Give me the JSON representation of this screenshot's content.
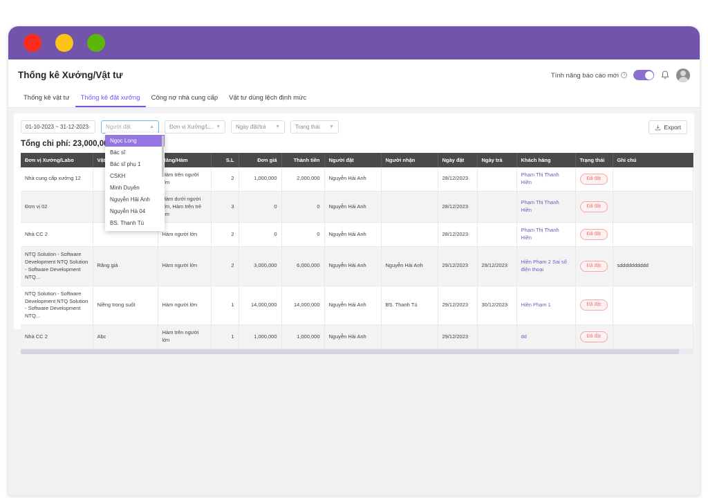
{
  "window": {
    "traffic_lights": [
      "close-red",
      "minimize-yellow",
      "maximize-green"
    ]
  },
  "header": {
    "page_title": "Thống kê Xưởng/Vật tư",
    "report_feature_label": "Tính năng báo cáo mới",
    "toggle_on": true,
    "bell_icon": "bell-icon",
    "avatar": "user-avatar"
  },
  "tabs": [
    {
      "label": "Thống kê vật tư",
      "active": false
    },
    {
      "label": "Thống kê đặt xưởng",
      "active": true
    },
    {
      "label": "Công nợ nhà cung cấp",
      "active": false
    },
    {
      "label": "Vật tư dùng lệch định mức",
      "active": false
    }
  ],
  "filters": {
    "date_range": "01-10-2023 ~ 31-12-2023",
    "date_icon": "calendar-icon",
    "nguoi_dat_placeholder": "Người đặt",
    "nguoi_dat_value": "",
    "don_vi_xuong": "Đơn vị Xưởng/L...",
    "ngay_dat_tra": "Ngày đặt/trả",
    "trang_thai": "Trạng thái",
    "export_label": "Export",
    "export_icon": "download-icon"
  },
  "dropdown": {
    "open": true,
    "options": [
      "Ngọc Long",
      "Bác sĩ",
      "Bác sĩ phụ 1",
      "CSKH",
      "Minh Duyên",
      "Nguyễn Hải Anh",
      "Nguyễn Hà 04",
      "BS. Thanh Tú"
    ],
    "selected_index": 0
  },
  "summary": {
    "total_cost_label": "Tổng chi phí: 23,000,000"
  },
  "table": {
    "columns": [
      "Đơn vị Xưởng/Labo",
      "Vật tư",
      "Răng/Hàm",
      "S.L",
      "Đơn giá",
      "Thành tiền",
      "Người đặt",
      "Người nhận",
      "Ngày đặt",
      "Ngày trả",
      "Khách hàng",
      "Trạng thái",
      "Ghi chú"
    ],
    "rows": [
      {
        "don_vi": "Nhà cung cấp xưởng 12",
        "vat_tu": "",
        "rang_ham": "Hàm trên người lớn",
        "sl": "2",
        "don_gia": "1,000,000",
        "thanh_tien": "2,000,000",
        "nguoi_dat": "Nguyễn Hải Anh",
        "nguoi_nhan": "",
        "ngay_dat": "28/12/2023",
        "ngay_tra": "",
        "khach_hang": "Phạm Thị Thanh Hiền",
        "trang_thai": "Đã đặt",
        "ghi_chu": ""
      },
      {
        "don_vi": "Đơn vị 02",
        "vat_tu": "",
        "rang_ham": "Hàm dưới người lớn, Hàm trên trẻ em",
        "sl": "3",
        "don_gia": "0",
        "thanh_tien": "0",
        "nguoi_dat": "Nguyễn Hải Anh",
        "nguoi_nhan": "",
        "ngay_dat": "28/12/2023",
        "ngay_tra": "",
        "khach_hang": "Phạm Thị Thanh Hiền",
        "trang_thai": "Đã đặt",
        "ghi_chu": ""
      },
      {
        "don_vi": "Nhà CC 2",
        "vat_tu": "",
        "rang_ham": "Hàm người lớn",
        "sl": "2",
        "don_gia": "0",
        "thanh_tien": "0",
        "nguoi_dat": "Nguyễn Hải Anh",
        "nguoi_nhan": "",
        "ngay_dat": "28/12/2023",
        "ngay_tra": "",
        "khach_hang": "Phạm Thị Thanh Hiền",
        "trang_thai": "Đã đặt",
        "ghi_chu": ""
      },
      {
        "don_vi": "NTQ Solution - Software Development NTQ Solution - Software Development NTQ...",
        "vat_tu": "Răng giả",
        "rang_ham": "Hàm người lớn",
        "sl": "2",
        "don_gia": "3,000,000",
        "thanh_tien": "6,000,000",
        "nguoi_dat": "Nguyễn Hải Anh",
        "nguoi_nhan": "Nguyễn Hải Anh",
        "ngay_dat": "29/12/2023",
        "ngay_tra": "29/12/2023",
        "khach_hang": "Hiền Phạm 2 Sai số điện thoại",
        "trang_thai": "Đã đặt",
        "ghi_chu": "sdddddddddd"
      },
      {
        "don_vi": "NTQ Solution - Software Development NTQ Solution - Software Development NTQ...",
        "vat_tu": "Niềng trong suốt",
        "rang_ham": "Hàm người lớn",
        "sl": "1",
        "don_gia": "14,000,000",
        "thanh_tien": "14,000,000",
        "nguoi_dat": "Nguyễn Hải Anh",
        "nguoi_nhan": "BS. Thanh Tú",
        "ngay_dat": "29/12/2023",
        "ngay_tra": "30/12/2023",
        "khach_hang": "Hiền Phạm 1",
        "trang_thai": "Đã đặt",
        "ghi_chu": ""
      },
      {
        "don_vi": "Nhà CC 2",
        "vat_tu": "Abc",
        "rang_ham": "Hàm trên người lớn",
        "sl": "1",
        "don_gia": "1,000,000",
        "thanh_tien": "1,000,000",
        "nguoi_dat": "Nguyễn Hải Anh",
        "nguoi_nhan": "",
        "ngay_dat": "29/12/2023",
        "ngay_tra": "",
        "khach_hang": "dd",
        "trang_thai": "Đã đặt",
        "ghi_chu": ""
      }
    ]
  },
  "colors": {
    "titlebar_purple": "#7254ab",
    "accent_purple": "#7c4dff",
    "header_dark": "#4a4a4a",
    "badge_red": "#f07575",
    "customer_link": "#6d5bbd"
  }
}
